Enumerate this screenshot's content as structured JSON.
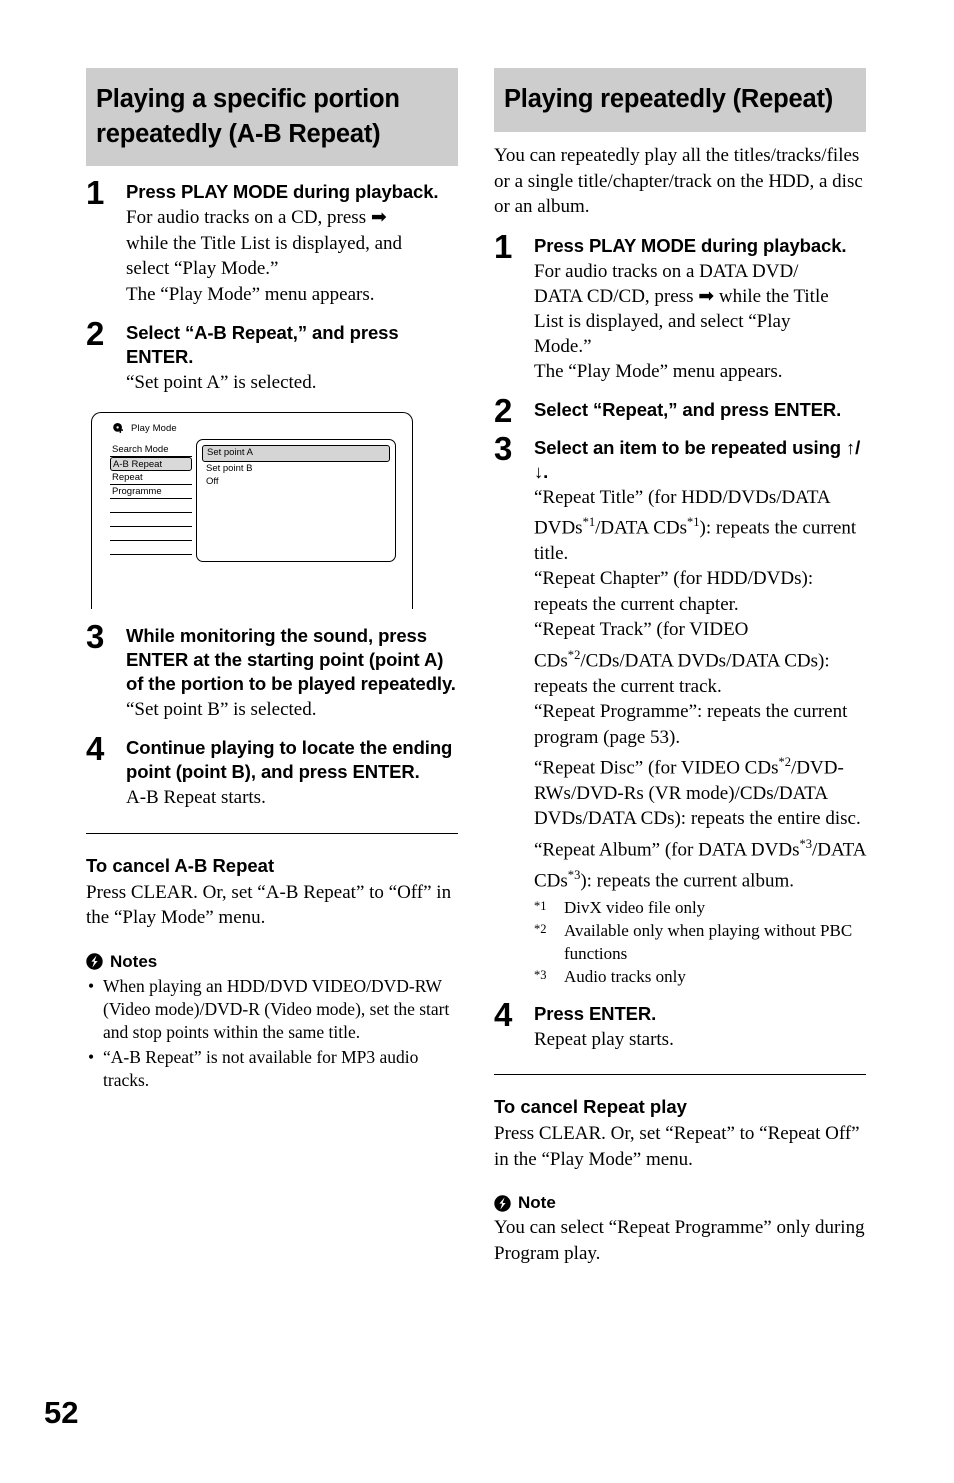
{
  "page_number": "52",
  "colors": {
    "band_gray": "#cdcdcd",
    "highlight_gray": "#d5d5d5",
    "text": "#000000"
  },
  "left_column": {
    "heading": "Playing a specific portion repeatedly (A-B Repeat)",
    "steps": [
      {
        "num": "1",
        "title": "Press PLAY MODE during playback.",
        "body_line1": "For audio tracks on a CD, press ➡",
        "body_line2": "while the Title List is displayed, and",
        "body_line3": "select “Play Mode.”",
        "body_line4": "The “Play Mode” menu appears."
      },
      {
        "num": "2",
        "title": "Select “A-B Repeat,” and press ENTER.",
        "body": "“Set point A” is selected."
      },
      {
        "num": "3",
        "title": "While monitoring the sound, press ENTER at the starting point (point A) of the portion to be played repeatedly.",
        "body": "“Set point B” is selected."
      },
      {
        "num": "4",
        "title": "Continue playing to locate the ending point (point B), and press ENTER.",
        "body": "A-B Repeat starts."
      }
    ],
    "osd": {
      "icon": "hdd-icon",
      "title": "Play Mode",
      "menu_items": [
        "Search Mode",
        "A-B Repeat",
        "Repeat",
        "Programme"
      ],
      "selected_menu_item": "A-B Repeat",
      "empty_rows": 4,
      "options": [
        "Set point A",
        "Set point B",
        "Off"
      ],
      "highlighted_option": "Set point A"
    },
    "cancel": {
      "heading": "To cancel A-B Repeat",
      "body": "Press CLEAR. Or, set “A-B Repeat” to “Off” in the “Play Mode” menu."
    },
    "notes": {
      "icon": "bolt-icon",
      "label": "Notes",
      "items": [
        "When playing an HDD/DVD VIDEO/DVD-RW (Video mode)/DVD-R (Video mode), set the start and stop points within the same title.",
        "“A-B Repeat” is not available for MP3 audio tracks."
      ]
    }
  },
  "right_column": {
    "heading": "Playing repeatedly (Repeat)",
    "intro": "You can repeatedly play all the titles/tracks/files or a single title/chapter/track on the HDD, a disc or an album.",
    "steps": [
      {
        "num": "1",
        "title": "Press PLAY MODE during playback.",
        "body_line1": "For audio tracks on a DATA DVD/",
        "body_line2": "DATA CD/CD, press ➡ while the Title",
        "body_line3": "List is displayed, and select “Play",
        "body_line4": "Mode.”",
        "body_line5": "The “Play Mode” menu appears."
      },
      {
        "num": "2",
        "title": "Select “Repeat,” and press ENTER."
      },
      {
        "num": "3",
        "title_part1": "Select an item to be repeated using ",
        "title_arrows": "↑/↓",
        "title_part2": "."
      },
      {
        "num": "4",
        "title": "Press ENTER.",
        "body": "Repeat play starts."
      }
    ],
    "repeat_items": [
      {
        "segments": [
          {
            "t": "“Repeat Title” (for HDD/DVDs/DATA DVDs"
          },
          {
            "t": "*1",
            "sup": true
          },
          {
            "t": "/DATA CDs"
          },
          {
            "t": "*1",
            "sup": true
          },
          {
            "t": "): repeats the current title."
          }
        ]
      },
      {
        "segments": [
          {
            "t": "“Repeat Chapter” (for HDD/DVDs): repeats the current chapter."
          }
        ]
      },
      {
        "segments": [
          {
            "t": "“Repeat Track” (for VIDEO CDs"
          },
          {
            "t": "*2",
            "sup": true
          },
          {
            "t": "/CDs/DATA DVDs/DATA CDs): repeats the current track."
          }
        ]
      },
      {
        "segments": [
          {
            "t": "“Repeat Programme”: repeats the current program (page 53)."
          }
        ]
      },
      {
        "segments": [
          {
            "t": "“Repeat Disc” (for VIDEO CDs"
          },
          {
            "t": "*2",
            "sup": true
          },
          {
            "t": "/DVD-RWs/DVD-Rs (VR mode)/CDs/DATA DVDs/DATA CDs): repeats the entire disc."
          }
        ]
      },
      {
        "segments": [
          {
            "t": "“Repeat Album” (for DATA DVDs"
          },
          {
            "t": "*3",
            "sup": true
          },
          {
            "t": "/DATA CDs"
          },
          {
            "t": "*3",
            "sup": true
          },
          {
            "t": "): repeats the current album."
          }
        ]
      }
    ],
    "footnotes": [
      {
        "mark": "*1",
        "text": "DivX video file only"
      },
      {
        "mark": "*2",
        "text": "Available only when playing without PBC functions"
      },
      {
        "mark": "*3",
        "text": "Audio tracks only"
      }
    ],
    "cancel": {
      "heading": "To cancel Repeat play",
      "body": "Press CLEAR. Or, set “Repeat” to “Repeat Off” in the “Play Mode” menu."
    },
    "note": {
      "icon": "bolt-icon",
      "label": "Note",
      "body": "You can select “Repeat Programme” only during Program play."
    }
  }
}
